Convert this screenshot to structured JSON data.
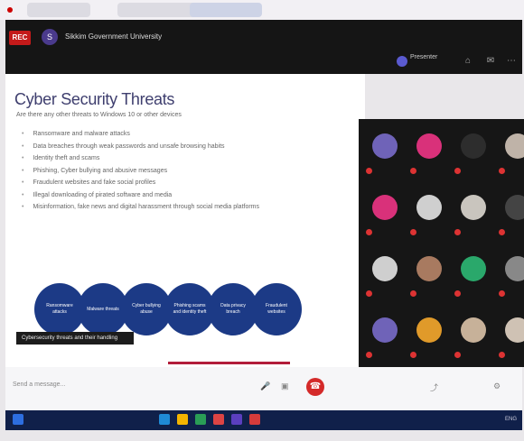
{
  "header": {
    "rec_badge": "REC",
    "avatar_initial": "S",
    "title": "Sikkim Government University",
    "presenter_name": "Presenter"
  },
  "slide": {
    "title": "Cyber Security Threats",
    "subtitle": "Are there any other threats to Windows 10 or other devices",
    "bullets": [
      "Ransomware and malware attacks",
      "Data breaches through weak passwords and unsafe browsing habits",
      "Identity theft and scams",
      "Phishing, Cyber bullying and abusive messages",
      "Fraudulent websites and fake social profiles",
      "Illegal downloading of pirated software and media",
      "Misinformation, fake news and digital harassment through social media platforms"
    ],
    "circles": [
      "Ransomware attacks",
      "Malware threats",
      "Cyber bullying abuse",
      "Phishing scams and identity theft",
      "Data privacy breach",
      "Fraudulent websites"
    ],
    "caption": "Cybersecurity threats and their handling"
  },
  "participants": [
    {
      "name": "",
      "color": "#6f63b8",
      "initial": ""
    },
    {
      "name": "",
      "color": "#d9317a",
      "initial": ""
    },
    {
      "name": "",
      "color": "#2d2d2d",
      "initial": ""
    },
    {
      "name": "",
      "color": "#bfb3a8",
      "initial": ""
    },
    {
      "name": "",
      "color": "#d9317a",
      "initial": ""
    },
    {
      "name": "",
      "color": "#cfcfcf",
      "initial": ""
    },
    {
      "name": "",
      "color": "#c9c5be",
      "initial": ""
    },
    {
      "name": "",
      "color": "#444444",
      "initial": ""
    },
    {
      "name": "",
      "color": "#cfcfcf",
      "initial": ""
    },
    {
      "name": "",
      "color": "#a87a60",
      "initial": ""
    },
    {
      "name": "",
      "color": "#2aa86b",
      "initial": ""
    },
    {
      "name": "",
      "color": "#888888",
      "initial": ""
    },
    {
      "name": "",
      "color": "#6f63b8",
      "initial": ""
    },
    {
      "name": "",
      "color": "#e09a2a",
      "initial": ""
    },
    {
      "name": "",
      "color": "#c7b199",
      "initial": ""
    },
    {
      "name": "",
      "color": "#cfc2b4",
      "initial": ""
    }
  ],
  "footer": {
    "message_placeholder": "Send a message...",
    "end_call_symbol": "☎"
  },
  "taskbar": {
    "tray_text": "ENG"
  },
  "colors": {
    "slide_title": "#3e3e6e",
    "circle_fill": "#1c3a86",
    "rec_badge": "#c41a1a",
    "end_call": "#d42a2a"
  }
}
